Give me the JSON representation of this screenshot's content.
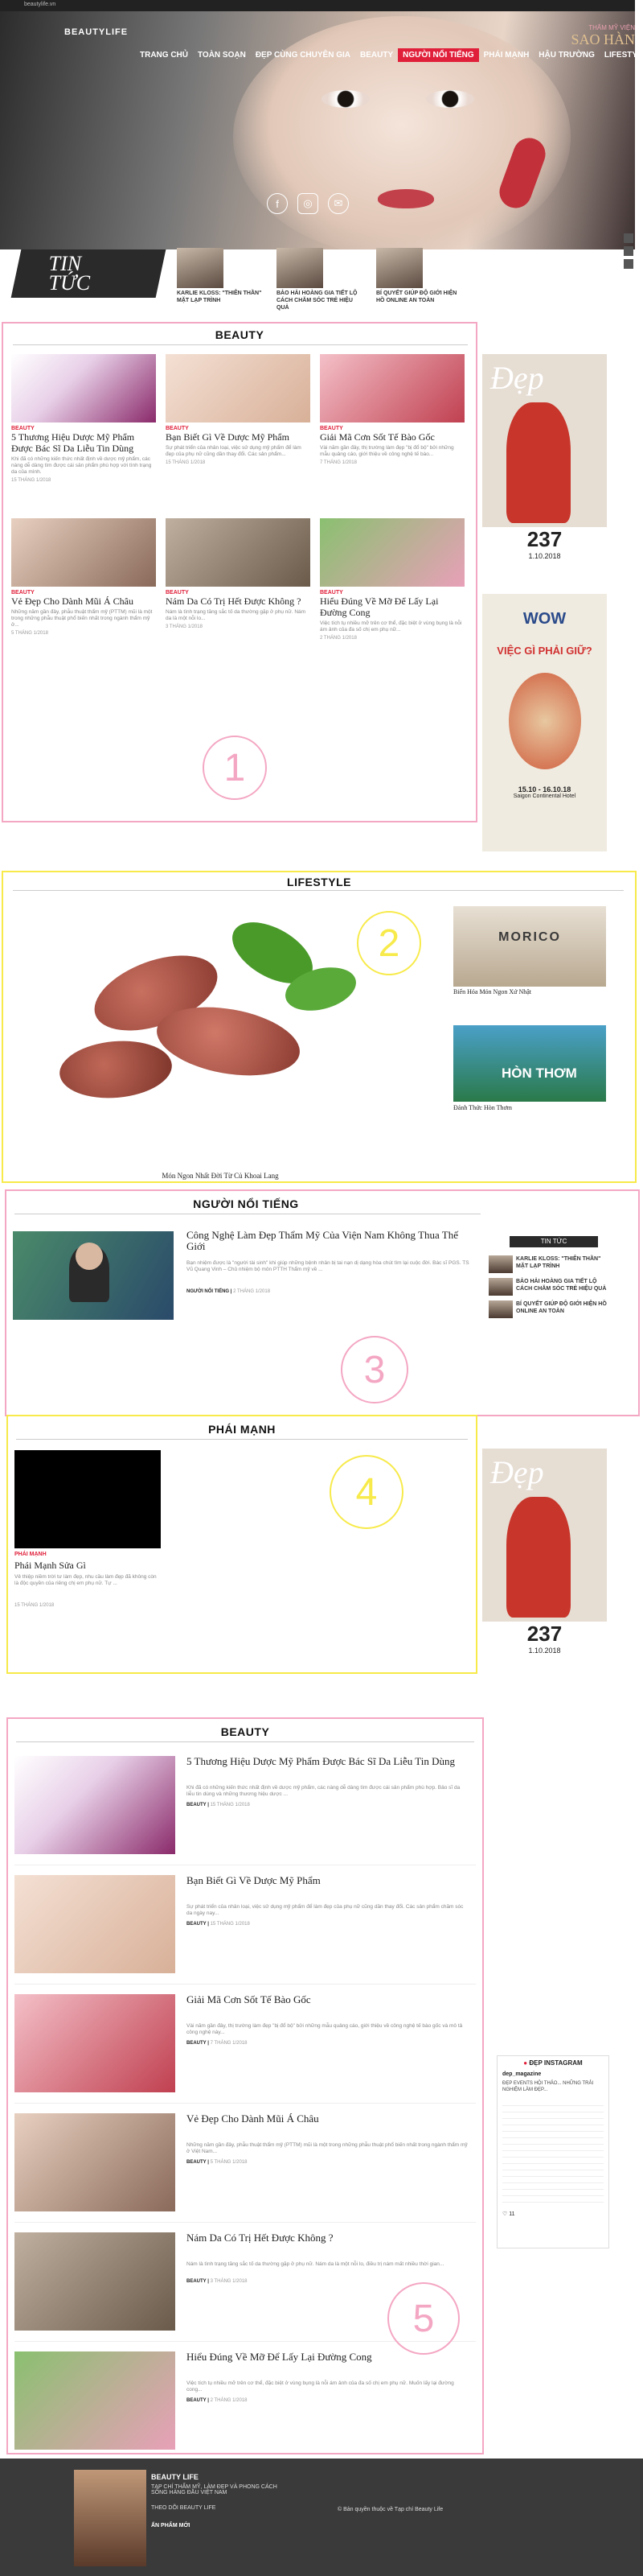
{
  "browser": {
    "address": "beautylife.vn"
  },
  "header": {
    "logo": "BEAUTYLIFE",
    "sponsor_line1": "THẨM MỸ VIỆN",
    "sponsor_line2": "SAO HÀN",
    "nav": [
      "TRANG CHỦ",
      "TOÀN SOẠN",
      "ĐẸP CÙNG CHUYÊN GIA",
      "BEAUTY",
      "NGƯỜI NỔI TIẾNG",
      "PHÁI MẠNH",
      "HẬU TRƯỜNG",
      "LIFESTYLE"
    ],
    "active_nav": "NGƯỜI NỔI TIẾNG"
  },
  "news_bar": {
    "title_line1": "TIN",
    "title_line2": "TỨC",
    "items": [
      "KARLIE KLOSS: \"THIÊN THẦN\" MẶT LẠP TRÌNH",
      "BẢO HẢI HOÀNG GIA TIẾT LỘ CÁCH CHĂM SÓC TRẺ HIỆU QUẢ",
      "BÍ QUYẾT GIÚP ĐỘ GIỚI HIỆN HỒ ONLINE AN TOÀN"
    ]
  },
  "beauty": {
    "title": "BEAUTY",
    "section_number": "1",
    "cards": [
      {
        "cat": "BEAUTY",
        "title": "5 Thương Hiệu Dược Mỹ Phẩm Được Bác Sĩ Da Liễu Tin Dùng",
        "excerpt": "Khi đã có những kiến thức nhất định về dược mỹ phẩm, các nàng dễ dàng tìm được cái sản phẩm phù hợp với tình trạng da của mình.",
        "date": "15 THÁNG 1/2018"
      },
      {
        "cat": "BEAUTY",
        "title": "Bạn Biết Gì Về Dược Mỹ Phẩm",
        "excerpt": "Sự phát triển của nhân loại, việc sử dụng mỹ phẩm để làm đẹp của phụ nữ cũng dần thay đổi. Các sản phẩm...",
        "date": "15 THÁNG 1/2018"
      },
      {
        "cat": "BEAUTY",
        "title": "Giải Mã Cơn Sốt Tế Bào Gốc",
        "excerpt": "Vài năm gần đây, thị trường làm đẹp \"bị đổ bộ\" bởi những mẫu quảng cáo, giới thiệu về công nghệ tế bào...",
        "date": "7 THÁNG 1/2018"
      },
      {
        "cat": "BEAUTY",
        "title": "Vẻ Đẹp Cho Dành Mũi Á Châu",
        "excerpt": "Những năm gần đây, phẫu thuật thẩm mỹ (PTTM) mũi là một trong những phẫu thuật phổ biến nhất trong ngành thẩm mỹ ở...",
        "date": "5 THÁNG 1/2018"
      },
      {
        "cat": "BEAUTY",
        "title": "Nám Da Có Trị Hết Được Không ?",
        "excerpt": "Nám là tình trạng tăng sắc tố da thường gặp ở phụ nữ. Nám da là một nỗi lo...",
        "date": "3 THÁNG 1/2018"
      },
      {
        "cat": "BEAUTY",
        "title": "Hiểu Đúng Về Mỡ Để Lấy Lại Đường Cong",
        "excerpt": "Việc tích tụ nhiều mỡ trên cơ thể, đặc biệt ở vùng bụng là nỗi ám ảnh của đa số chị em phụ nữ...",
        "date": "2 THÁNG 1/2018"
      }
    ]
  },
  "magazine": {
    "title": "Đẹp",
    "issue": "237",
    "date": "1.10.2018",
    "ad_title": "WOW",
    "ad_text": "VIỆC GÌ PHẢI GIỮ?",
    "ad_venue": "Saigon Continental Hotel",
    "ad_dates": "15.10 - 16.10.18"
  },
  "lifestyle": {
    "title": "LIFESTYLE",
    "section_number": "2",
    "main_caption": "Món Ngon Nhất Đời Từ Củ Khoai Lang",
    "side": [
      {
        "title": "Biến Hóa Món Ngon Xứ Nhật",
        "img_label": "MORICO"
      },
      {
        "title": "Đánh Thức Hòn Thơm",
        "img_label": "HÒN THƠM"
      }
    ]
  },
  "celebrity": {
    "title": "NGƯỜI NỔI TIẾNG",
    "section_number": "3",
    "article": {
      "title": "Công Nghệ Làm Đẹp Thẩm Mỹ Của Viện Nam Không Thua Thế Giới",
      "excerpt": "Bạn nhiệm được là \"người tài sinh\" khi giúp những bệnh nhân bị tai nạn dị dạng hòa chút tìm lại cuộc đời. Bác sĩ PGS. TS Vũ Quang Vinh – Chủ nhiệm bộ môn PTTH Thẩm mỹ về ...",
      "cat": "NGƯỜI NỔI TIẾNG",
      "date": "2 THÁNG 1/2018"
    },
    "side_title": "TIN TỨC",
    "side_items": [
      "KARLIE KLOSS: \"THIÊN THẦN\" MẶT LẠP TRÌNH",
      "BẢO HẢI HOÀNG GIA TIẾT LỘ CÁCH CHĂM SÓC TRẺ HIỆU QUẢ",
      "BÍ QUYẾT GIÚP ĐỘ GIỚI HIỆN HỒ ONLINE AN TOÀN"
    ]
  },
  "phai_manh": {
    "title": "PHÁI MẠNH",
    "section_number": "4",
    "article": {
      "cat": "PHÁI MẠNH",
      "title": "Phái Mạnh Sửa Gì",
      "excerpt": "Vẻ thiệp niềm trời tư làm đẹp, nhu cầu làm đẹp đã không còn là độc quyền của riêng chị em phụ nữ. Tự ...",
      "date": "15 THÁNG 1/2018"
    }
  },
  "beauty2": {
    "title": "BEAUTY",
    "section_number": "5",
    "items": [
      {
        "title": "5 Thương Hiệu Dược Mỹ Phẩm Được Bác Sĩ Da Liễu Tin Dùng",
        "excerpt": "Khi đã có những kiến thức nhất định về dược mỹ phẩm, các nàng dễ dàng tìm được cái sản phẩm phù hợp. Bảo sĩ da liễu tin dùng và những thương hiệu dược ...",
        "cat": "BEAUTY",
        "date": "15 THÁNG 1/2018"
      },
      {
        "title": "Bạn Biết Gì Về Dược Mỹ Phẩm",
        "excerpt": "Sự phát triển của nhân loại, việc sử dụng mỹ phẩm để làm đẹp của phụ nữ cũng dần thay đổi. Các sản phẩm chăm sóc da ngày nay...",
        "cat": "BEAUTY",
        "date": "15 THÁNG 1/2018"
      },
      {
        "title": "Giải Mã Cơn Sốt Tế Bào Gốc",
        "excerpt": "Vài năm gần đây, thị trường làm đẹp \"bị đổ bộ\" bởi những mẫu quảng cáo, giới thiệu về công nghệ tế bào gốc và mô tả công nghệ này...",
        "cat": "BEAUTY",
        "date": "7 THÁNG 1/2018"
      },
      {
        "title": "Vẻ Đẹp Cho Dành Mũi Á Châu",
        "excerpt": "Những năm gần đây, phẫu thuật thẩm mỹ (PTTM) mũi là một trong những phẫu thuật phổ biến nhất trong ngành thẩm mỹ ở Việt Nam...",
        "cat": "BEAUTY",
        "date": "5 THÁNG 1/2018"
      },
      {
        "title": "Nám Da Có Trị Hết Được Không ?",
        "excerpt": "Nám là tình trạng tăng sắc tố da thường gặp ở phụ nữ. Nám da là một nỗi lo, điều trị nám mất nhiều thời gian...",
        "cat": "BEAUTY",
        "date": "3 THÁNG 1/2018"
      },
      {
        "title": "Hiểu Đúng Về Mỡ Để Lấy Lại Đường Cong",
        "excerpt": "Việc tích tụ nhiều mỡ trên cơ thể, đặc biệt ở vùng bụng là nỗi ám ảnh của đa số chị em phụ nữ. Muốn lấy lại đường cong...",
        "cat": "BEAUTY",
        "date": "2 THÁNG 1/2018"
      }
    ]
  },
  "instagram": {
    "title": "ĐẸP INSTAGRAM",
    "handle": "dep_magazine",
    "caption": "ĐẸP EVENTS HỘI THẢO... NHỮNG TRẢI NGHIỆM LÀM ĐẸP...",
    "likes": "11"
  },
  "footer": {
    "brand": "BEAUTY LIFE",
    "tagline": "TẠP CHÍ THẨM MỸ, LÀM ĐẸP VÀ PHONG CÁCH SỐNG HÀNG ĐẦU VIỆT NAM",
    "follow": "THEO DÕI BEAUTY LIFE",
    "new_issue": "ẤN PHẨM MỚI",
    "copyright": "© Bản quyền thuộc về Tạp chí Beauty Life"
  }
}
